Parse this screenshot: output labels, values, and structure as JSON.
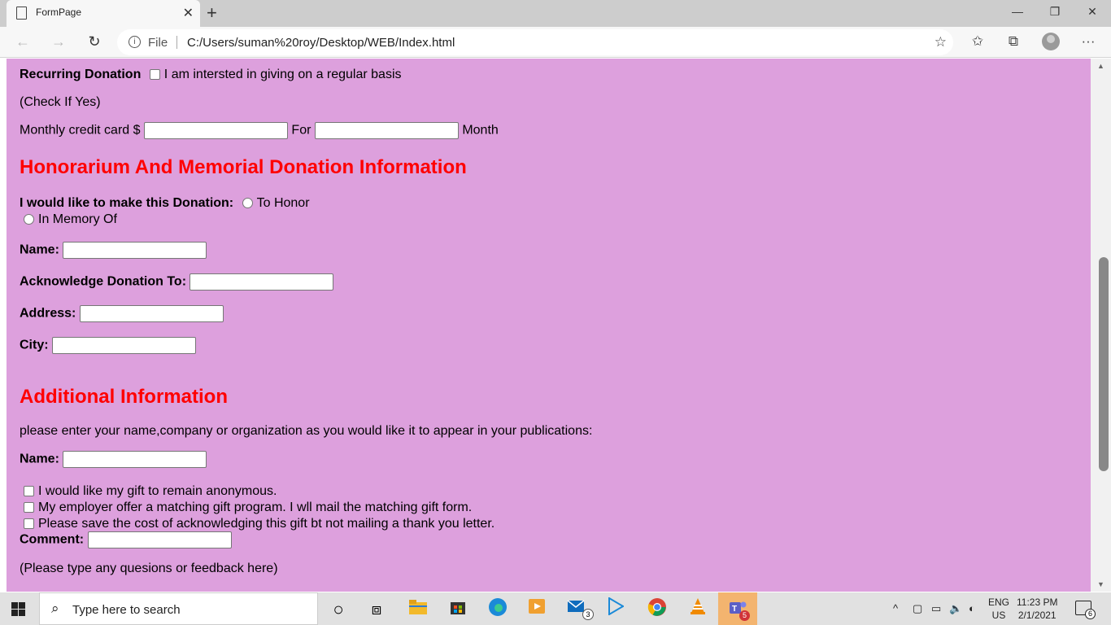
{
  "browser": {
    "tab_title": "FormPage",
    "tab_close": "✕",
    "new_tab": "+",
    "minimize": "—",
    "restore": "❐",
    "close": "✕",
    "back": "←",
    "forward": "→",
    "reload": "↻",
    "info": "i",
    "file_label": "File",
    "url": "C:/Users/suman%20roy/Desktop/WEB/Index.html",
    "fav_add": "☆",
    "favorites": "✩",
    "collections": "⧉",
    "more": "···"
  },
  "form": {
    "recurring_label": "Recurring Donation",
    "recurring_text": "I am intersted in giving on a regular basis",
    "check_if_yes": "(Check If Yes)",
    "monthly_label": "Monthly credit card $",
    "for_label": "For",
    "month_label": "Month",
    "honor_heading": "Honorarium And Memorial Donation Information",
    "donation_label": "I would like to make this Donation:",
    "to_honor": "To Honor",
    "in_memory": "In Memory Of",
    "name_label": "Name:",
    "acknowledge_label": "Acknowledge Donation To:",
    "address_label": "Address:",
    "city_label": "City:",
    "additional_heading": "Additional Information",
    "publication_text": "please enter your name,company or organization as you would like it to appear in your publications:",
    "name2_label": "Name:",
    "anonymous_text": "I would like my gift to remain anonymous.",
    "employer_text": "My employer offer a matching gift program. I wll mail the matching gift form.",
    "save_cost_text": "Please save the cost of acknowledging this gift bt not mailing a thank you letter.",
    "comment_label": "Comment:",
    "feedback_text": "(Please type any quesions or feedback here)"
  },
  "taskbar": {
    "search_placeholder": "Type here to search",
    "search_icon": "⌕",
    "cortana": "○",
    "task_view": "⧈",
    "mail_badge": "3",
    "teams_badge": "5",
    "lang_top": "ENG",
    "lang_bottom": "US",
    "time": "11:23 PM",
    "date": "2/1/2021",
    "notification_count": "6"
  }
}
